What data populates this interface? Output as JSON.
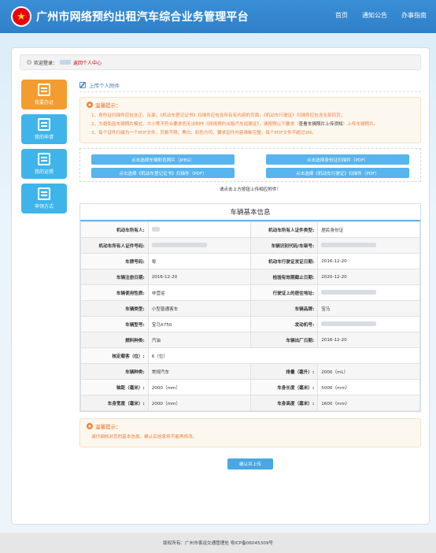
{
  "header": {
    "site_title": "广州市网络预约出租汽车综合业务管理平台",
    "nav": [
      "首页",
      "通知公告",
      "办事指南"
    ]
  },
  "breadcrumb": {
    "prefix": "欢迎登录：",
    "link": "返回个人中心"
  },
  "sidebar": {
    "items": [
      {
        "label": "我要办证",
        "icon": "id-card-icon",
        "active": true
      },
      {
        "label": "我的申请",
        "icon": "edit-form-icon"
      },
      {
        "label": "我的证照",
        "icon": "certificate-icon"
      },
      {
        "label": "申领方式",
        "icon": "id-badge-icon"
      }
    ]
  },
  "upload": {
    "title": "上传个人附件",
    "tips_title": "温馨提示：",
    "tip1": "1、身份证扫描件应包含正、反面；《机动车登记证书》扫描件应包含所有有内容的页面；《机动车行驶证》扫描件应包含全部四页；",
    "tip2a": "2、为避免因车辆照片模式、大小等不符合要求而无法制作《网络预约出租汽车运输证》，请按照以下要求（",
    "tip2b": "查看车辆照片上传须知",
    "tip2c": "）上传车辆照片。",
    "tip3": "3、每个证件扫描为一个PDF文件，页数不限，黑白、彩色均可，要求证件内容清晰完整，每个PDF文件不超过2M。",
    "btn_photo": "点击选择车辆彩色照片（JPEG）",
    "btn_idcard": "点击选择身份证扫描件（PDF）",
    "btn_register": "点击选择《机动车登记证书》扫描件（PDF）",
    "btn_license": "点击选择《机动车行驶证》扫描件（PDF）",
    "note": "请点击上方按钮上传相应附件！"
  },
  "vehicle": {
    "title": "车辆基本信息",
    "rows": [
      [
        {
          "k": "机动车所有人:",
          "v": ""
        },
        {
          "k": "机动车所有人证件类型:",
          "v": "居民身份证"
        }
      ],
      [
        {
          "k": "机动车所有人证件号码:",
          "v": ""
        },
        {
          "k": "车辆识别代码/车架号:",
          "v": ""
        }
      ],
      [
        {
          "k": "车牌号码:",
          "v": "粤"
        },
        {
          "k": "机动车行驶证发证日期:",
          "v": "2016-12-20"
        }
      ],
      [
        {
          "k": "车辆注册日期:",
          "v": "2016-12-20"
        },
        {
          "k": "检验有效期截止日期:",
          "v": "2020-12-20"
        }
      ],
      [
        {
          "k": "车辆使用性质:",
          "v": "非营运"
        },
        {
          "k": "行驶证上的居住地址:",
          "v": ""
        }
      ],
      [
        {
          "k": "车辆类型:",
          "v": "小型普通客车"
        },
        {
          "k": "车辆品牌:",
          "v": "宝马"
        }
      ],
      [
        {
          "k": "车辆型号:",
          "v": "宝马X750"
        },
        {
          "k": "发动机号:",
          "v": ""
        }
      ],
      [
        {
          "k": "燃料种类:",
          "v": "汽油"
        },
        {
          "k": "车辆出厂日期:",
          "v": "2016-12-20"
        }
      ],
      [
        {
          "k": "核定载客（位）:",
          "v": "6（位）"
        }
      ],
      [
        {
          "k": "车辆种类:",
          "v": "常规汽车"
        },
        {
          "k": "排量（毫升）:",
          "v": "2000（mL）"
        }
      ],
      [
        {
          "k": "轴距（毫米）:",
          "v": "2000（mm）"
        },
        {
          "k": "车身长度（毫米）:",
          "v": "5000（mm）"
        }
      ],
      [
        {
          "k": "车身宽度（毫米）:",
          "v": "2000（mm）"
        },
        {
          "k": "车身高度（毫米）:",
          "v": "1600（mm）"
        }
      ]
    ]
  },
  "confirm_tips": {
    "title": "温馨提示：",
    "text": "请仔细核对您的基本信息，确认后信息将不能再修改。"
  },
  "confirm_button": "确认并上传",
  "footer": "版权所有：广州市客运交通管理处  粤ICP备06045309号"
}
